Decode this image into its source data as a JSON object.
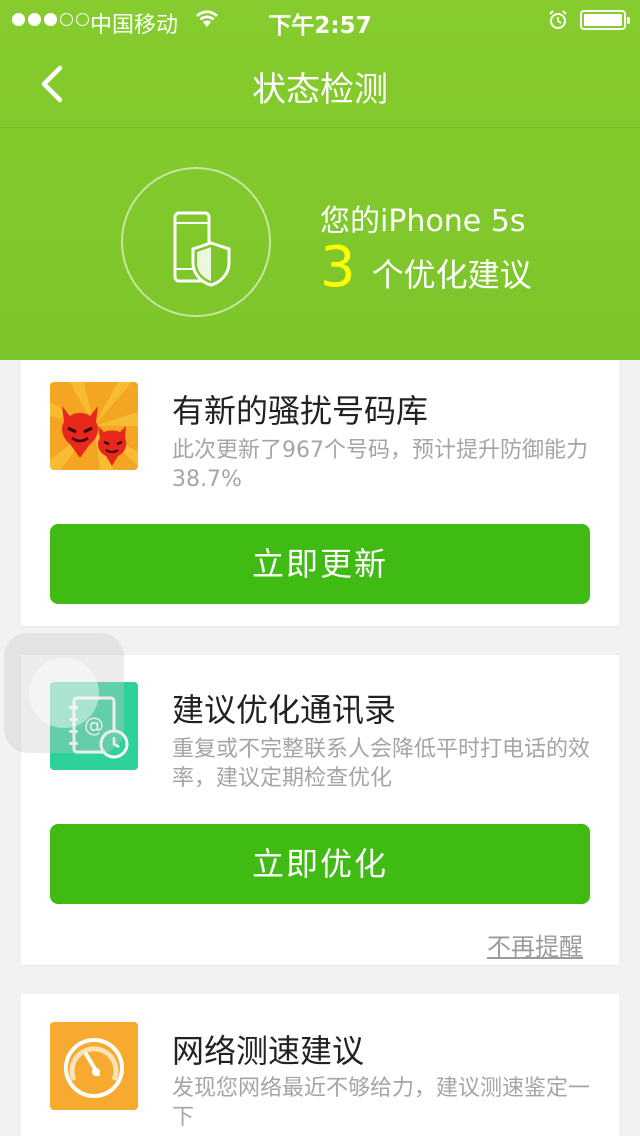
{
  "status_bar": {
    "carrier": "中国移动",
    "time": "下午2:57",
    "signal_bars_filled": 3,
    "signal_bars_total": 5
  },
  "nav": {
    "title": "状态检测",
    "back_icon": "chevron-left-icon"
  },
  "summary": {
    "device_line": "您的iPhone 5s",
    "count": "3",
    "suffix": "个优化建议",
    "icon": "phone-shield-icon"
  },
  "cards": [
    {
      "title": "有新的骚扰号码库",
      "description": "此次更新了967个号码，预计提升防御能力38.7%",
      "button": "立即更新",
      "icon": "devil-spam-icon"
    },
    {
      "title": "建议优化通讯录",
      "description": "重复或不完整联系人会降低平时打电话的效率，建议定期检查优化",
      "button": "立即优化",
      "dismiss": "不再提醒",
      "icon": "contacts-book-icon"
    },
    {
      "title": "网络测速建议",
      "description": "发现您网络最近不够给力，建议测速鉴定一下",
      "icon": "speedometer-icon"
    }
  ],
  "colors": {
    "header_green": "#7cc52a",
    "button_green": "#3fbb14",
    "highlight_yellow": "#ffff00"
  }
}
